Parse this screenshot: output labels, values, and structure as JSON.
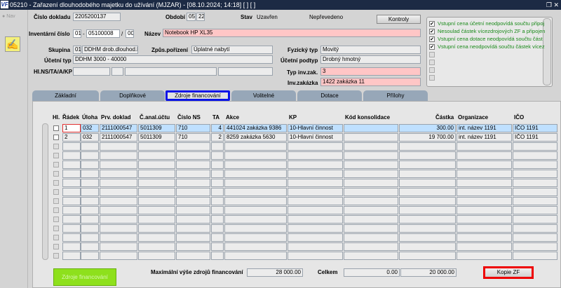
{
  "window": {
    "title": "05210 - Zařazení dlouhodobého majetku do užívání (MJZAR) - [08.10.2024; 14:18] [ ] [ ]",
    "logo": "VF"
  },
  "nav": {
    "label": "Nav"
  },
  "header": {
    "cislo_dokladu_label": "Číslo dokladu",
    "cislo_dokladu": "2205200137",
    "obdobi_label": "Období",
    "obdobi_m": "05",
    "obdobi_y": "22",
    "stav_label": "Stav",
    "stav": "Uzavřen",
    "prevod": "Nepřevedeno",
    "kontroly_label": "Kontroly",
    "inv_label": "Inventární číslo",
    "inv_a": "01",
    "inv_b": "05100008",
    "inv_c": "00",
    "nazev_label": "Název",
    "nazev": "Notebook HP XL35",
    "skupina_label": "Skupina",
    "skupina_kod": "01",
    "skupina": "DDHM drob.dlouhod.hm",
    "zpusob_label": "Způs.pořízení",
    "zpusob": "Úplatné nabytí",
    "ucetni_typ_label": "Účetní typ",
    "ucetni_typ": "DDHM 3000 - 40000",
    "hlns_label": "Hl.NS/TA/A/KP",
    "fyz_label": "Fyzický typ",
    "fyz": "Movitý",
    "podtyp_label": "Účetní podtyp",
    "podtyp": "Drobný hmotný",
    "typinv_label": "Typ inv.zak.",
    "typinv": "3",
    "invzak_label": "Inv.zakázka",
    "invzak": "1422 zakázka 11"
  },
  "checks": [
    {
      "checked": true,
      "text": "Vstupní cena účetní neodpovídá součtu připoj"
    },
    {
      "checked": true,
      "text": "Nesoulad částek vícezdrojových ZF a připojen"
    },
    {
      "checked": true,
      "text": "Vstupní cena dotace neodpovídá součtu část"
    },
    {
      "checked": true,
      "text": "Vstupní cena neodpovídá součtu částek vícez"
    }
  ],
  "tabs": [
    "Základní",
    "Doplňkové",
    "Zdroje financování",
    "Volitelné",
    "Dotace",
    "Přílohy"
  ],
  "grid": {
    "headers": [
      "Hl.",
      "Řádek",
      "Úloha",
      "Prv. doklad",
      "Č.anal.účtu",
      "Číslo NS",
      "TA",
      "Akce",
      "KP",
      "Kód konsolidace",
      "Částka",
      "Organizace",
      "IČO"
    ],
    "rows": [
      [
        "1",
        "032",
        "2111000547",
        "5011309",
        "710",
        "4",
        "441024 zakázka 9386",
        "10-Hlavní činnost",
        "",
        "300.00",
        "int. název 1191",
        "IČO 1191"
      ],
      [
        "2",
        "032",
        "2111000547",
        "5011309",
        "710",
        "2",
        "8259 zakázka 5630",
        "10-Hlavní činnost",
        "",
        "19 700.00",
        "int. název 1191",
        "IČO 1191"
      ]
    ]
  },
  "footer": {
    "zdroje_btn": "Zdroje financování",
    "max_label": "Maximální výše zdrojů financování",
    "max": "28 000.00",
    "celkem_label": "Celkem",
    "celkem1": "0.00",
    "celkem2": "20 000.00",
    "kopie_btn": "Kopie ZF"
  }
}
